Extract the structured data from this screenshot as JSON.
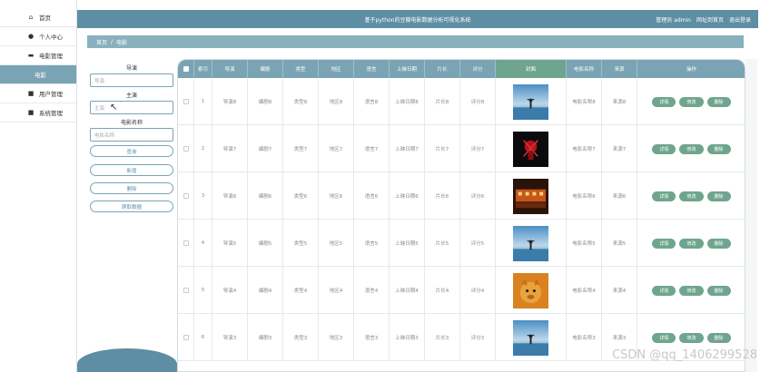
{
  "header": {
    "title": "基于python的豆瓣电影数据分析可视化系统",
    "user": "管理员 admin",
    "home_link": "网址到首页",
    "logout": "退出登录"
  },
  "sidebar": {
    "items": [
      {
        "label": "首页",
        "icon": "home-icon"
      },
      {
        "label": "个人中心",
        "icon": "user-icon"
      },
      {
        "label": "电影管理",
        "icon": "monitor-icon"
      },
      {
        "label": "电影",
        "icon": ""
      },
      {
        "label": "用户管理",
        "icon": "lock-icon"
      },
      {
        "label": "系统管理",
        "icon": "gear-icon"
      }
    ]
  },
  "breadcrumb": {
    "home": "首页",
    "sep": "/",
    "current": "电影"
  },
  "search": {
    "director_label": "导演",
    "director_placeholder": "导演",
    "actor_label": "主演",
    "actor_placeholder": "主演",
    "name_label": "电影名称",
    "name_placeholder": "电影名称",
    "query_btn": "查询",
    "add_btn": "新增",
    "delete_btn": "删除",
    "crawl_btn": "爬取数据"
  },
  "table": {
    "headers": [
      "索引",
      "导演",
      "编剧",
      "类型",
      "地区",
      "语言",
      "上映日期",
      "片长",
      "评分",
      "封面",
      "电影名称",
      "来源",
      "操作"
    ],
    "actions": {
      "detail": "详情",
      "edit": "修改",
      "delete": "删除"
    },
    "rows": [
      {
        "index": "1",
        "director": "导演8",
        "writer": "编剧8",
        "type": "类型8",
        "region": "地区8",
        "language": "语言8",
        "date": "上映日期8",
        "length": "片长8",
        "score": "评分8",
        "name": "电影名称8",
        "source": "来源8",
        "poster": "sea"
      },
      {
        "index": "2",
        "director": "导演7",
        "writer": "编剧7",
        "type": "类型7",
        "region": "地区7",
        "language": "语言7",
        "date": "上映日期7",
        "length": "片长7",
        "score": "评分7",
        "name": "电影名称7",
        "source": "来源7",
        "poster": "spider"
      },
      {
        "index": "3",
        "director": "导演6",
        "writer": "编剧6",
        "type": "类型6",
        "region": "地区6",
        "language": "语言6",
        "date": "上映日期6",
        "length": "片长6",
        "score": "评分6",
        "name": "电影名称6",
        "source": "来源6",
        "poster": "city"
      },
      {
        "index": "4",
        "director": "导演5",
        "writer": "编剧5",
        "type": "类型5",
        "region": "地区5",
        "language": "语言5",
        "date": "上映日期5",
        "length": "片长5",
        "score": "评分5",
        "name": "电影名称5",
        "source": "来源5",
        "poster": "sea"
      },
      {
        "index": "5",
        "director": "导演4",
        "writer": "编剧4",
        "type": "类型4",
        "region": "地区4",
        "language": "语言4",
        "date": "上映日期4",
        "length": "片长4",
        "score": "评分4",
        "name": "电影名称4",
        "source": "来源4",
        "poster": "lion"
      },
      {
        "index": "6",
        "director": "导演3",
        "writer": "编剧3",
        "type": "类型3",
        "region": "地区3",
        "language": "语言3",
        "date": "上映日期3",
        "length": "片长3",
        "score": "评分3",
        "name": "电影名称3",
        "source": "来源3",
        "poster": "sea"
      }
    ]
  },
  "watermark": "CSDN @qq_1406299528",
  "colors": {
    "primary": "#5e8ea4",
    "header_row": "#7aa4b3",
    "action_green": "#6fa58e"
  }
}
